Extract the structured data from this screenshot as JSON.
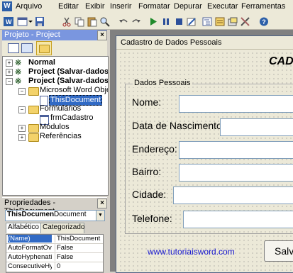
{
  "menu": [
    "Arquivo",
    "Editar",
    "Exibir",
    "Inserir",
    "Formatar",
    "Depurar",
    "Executar",
    "Ferramentas"
  ],
  "project": {
    "title": "Projeto - Project",
    "close": "×",
    "tree": {
      "normal": "Normal",
      "project1": "Project (Salvar-dados-n",
      "project2": "Project (Salvar-dados-n",
      "word_objects": "Microsoft Word Objetos",
      "this_document": "ThisDocument",
      "forms": "Formulários",
      "frm_cadastro": "frmCadastro",
      "modules": "Módulos",
      "references": "Referências"
    }
  },
  "properties": {
    "title": "Propriedades - ThisDocument",
    "close": "×",
    "object_name": "ThisDocumen",
    "object_type": "Document",
    "tabs": [
      "Alfabético",
      "Categorizado"
    ],
    "rows": [
      {
        "name": "(Name)",
        "value": "ThisDocument"
      },
      {
        "name": "AutoFormatOve",
        "value": "False"
      },
      {
        "name": "AutoHyphenatic",
        "value": "False"
      },
      {
        "name": "ConsecutiveHyp",
        "value": "0"
      }
    ]
  },
  "form": {
    "window_title": "Cadastro de Dados Pessoais",
    "heading": "CAD",
    "frame_caption": "Dados Pessoais",
    "labels": {
      "nome": "Nome:",
      "nascimento": "Data de Nascimento:",
      "endereco": "Endereço:",
      "bairro": "Bairro:",
      "cidade": "Cidade:",
      "telefone": "Telefone:"
    },
    "link": "www.tutoriaisword.com",
    "save_button": "Salva"
  }
}
